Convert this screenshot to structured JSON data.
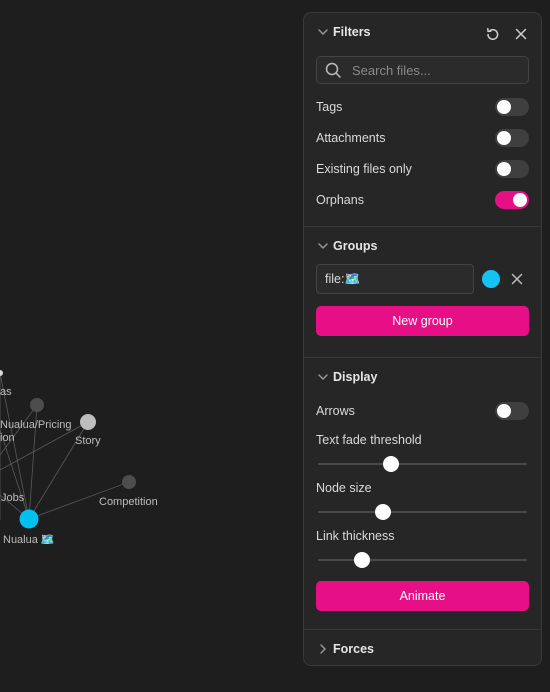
{
  "graph": {
    "nodes": [
      {
        "label": "",
        "color": "#d9d9d9"
      },
      {
        "label": "as",
        "color": "#d9d9d9"
      },
      {
        "label": "",
        "color": "#4d4d4d"
      },
      {
        "label": "Nualua/Pricing",
        "color": "#d9d9d9"
      },
      {
        "label": "ion",
        "color": "#d9d9d9"
      },
      {
        "label": "Story",
        "color": "#bdbdbd"
      },
      {
        "label": "Competition",
        "color": "#4d4d4d"
      },
      {
        "label": "Jobs",
        "color": "#d9d9d9"
      },
      {
        "label": "Nualua 🗺️",
        "color": "#00c0f0"
      }
    ]
  },
  "filters": {
    "title": "Filters",
    "search_placeholder": "Search files...",
    "toggles": [
      {
        "label": "Tags",
        "on": false
      },
      {
        "label": "Attachments",
        "on": false
      },
      {
        "label": "Existing files only",
        "on": false
      },
      {
        "label": "Orphans",
        "on": true
      }
    ]
  },
  "groups": {
    "title": "Groups",
    "query": "file:🗺️",
    "color": "#15c3f2",
    "new_group_label": "New group"
  },
  "display": {
    "title": "Display",
    "arrows_label": "Arrows",
    "arrows_on": false,
    "text_fade_label": "Text fade threshold",
    "text_fade_value": 0.35,
    "node_size_label": "Node size",
    "node_size_value": 0.31,
    "link_thickness_label": "Link thickness",
    "link_thickness_value": 0.21,
    "animate_label": "Animate"
  },
  "forces": {
    "title": "Forces"
  },
  "colors": {
    "accent": "#e60f86",
    "panel_bg": "#262626",
    "canvas_bg": "#1e1e1e"
  }
}
